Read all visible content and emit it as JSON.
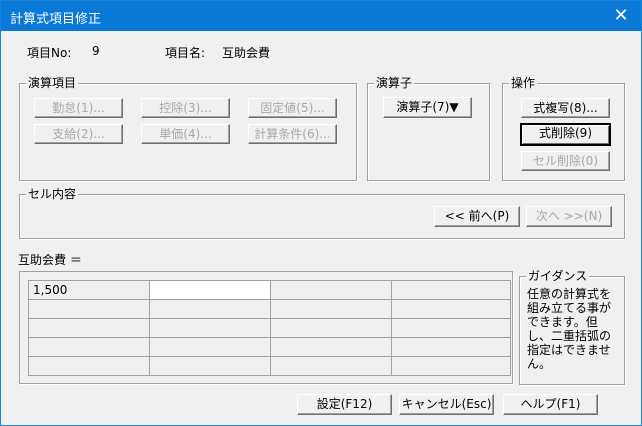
{
  "window": {
    "title": "計算式項目修正",
    "close_glyph": "✕"
  },
  "header": {
    "item_no_label": "項目No:",
    "item_no_value": "9",
    "item_name_label": "項目名:",
    "item_name_value": "互助会費"
  },
  "operand_group": {
    "title": "演算項目",
    "buttons": [
      "勤怠(1)...",
      "控除(3)...",
      "固定値(5)...",
      "支給(2)...",
      "単価(4)...",
      "計算条件(6)..."
    ]
  },
  "operator_group": {
    "title": "演算子",
    "button": "演算子(7)▼"
  },
  "action_group": {
    "title": "操作",
    "copy_button": "式複写(8)...",
    "delete_button": "式削除(9)",
    "cell_delete_button": "セル削除(0)"
  },
  "cell_group": {
    "title": "セル内容",
    "prev_button": "<< 前へ(P)",
    "next_button": "次へ >>(N)"
  },
  "formula": {
    "label": "互助会費 ＝",
    "rows": [
      [
        "1,500",
        "",
        "",
        ""
      ],
      [
        "",
        "",
        "",
        ""
      ],
      [
        "",
        "",
        "",
        ""
      ],
      [
        "",
        "",
        "",
        ""
      ],
      [
        "",
        "",
        "",
        ""
      ]
    ]
  },
  "guidance": {
    "title": "ガイダンス",
    "text": "任意の計算式を組み立てる事ができます。但し、二重括弧の指定はできません。"
  },
  "footer": {
    "set_button": "設定(F12)",
    "cancel_button": "キャンセル(Esc)",
    "help_button": "ヘルプ(F1)"
  }
}
